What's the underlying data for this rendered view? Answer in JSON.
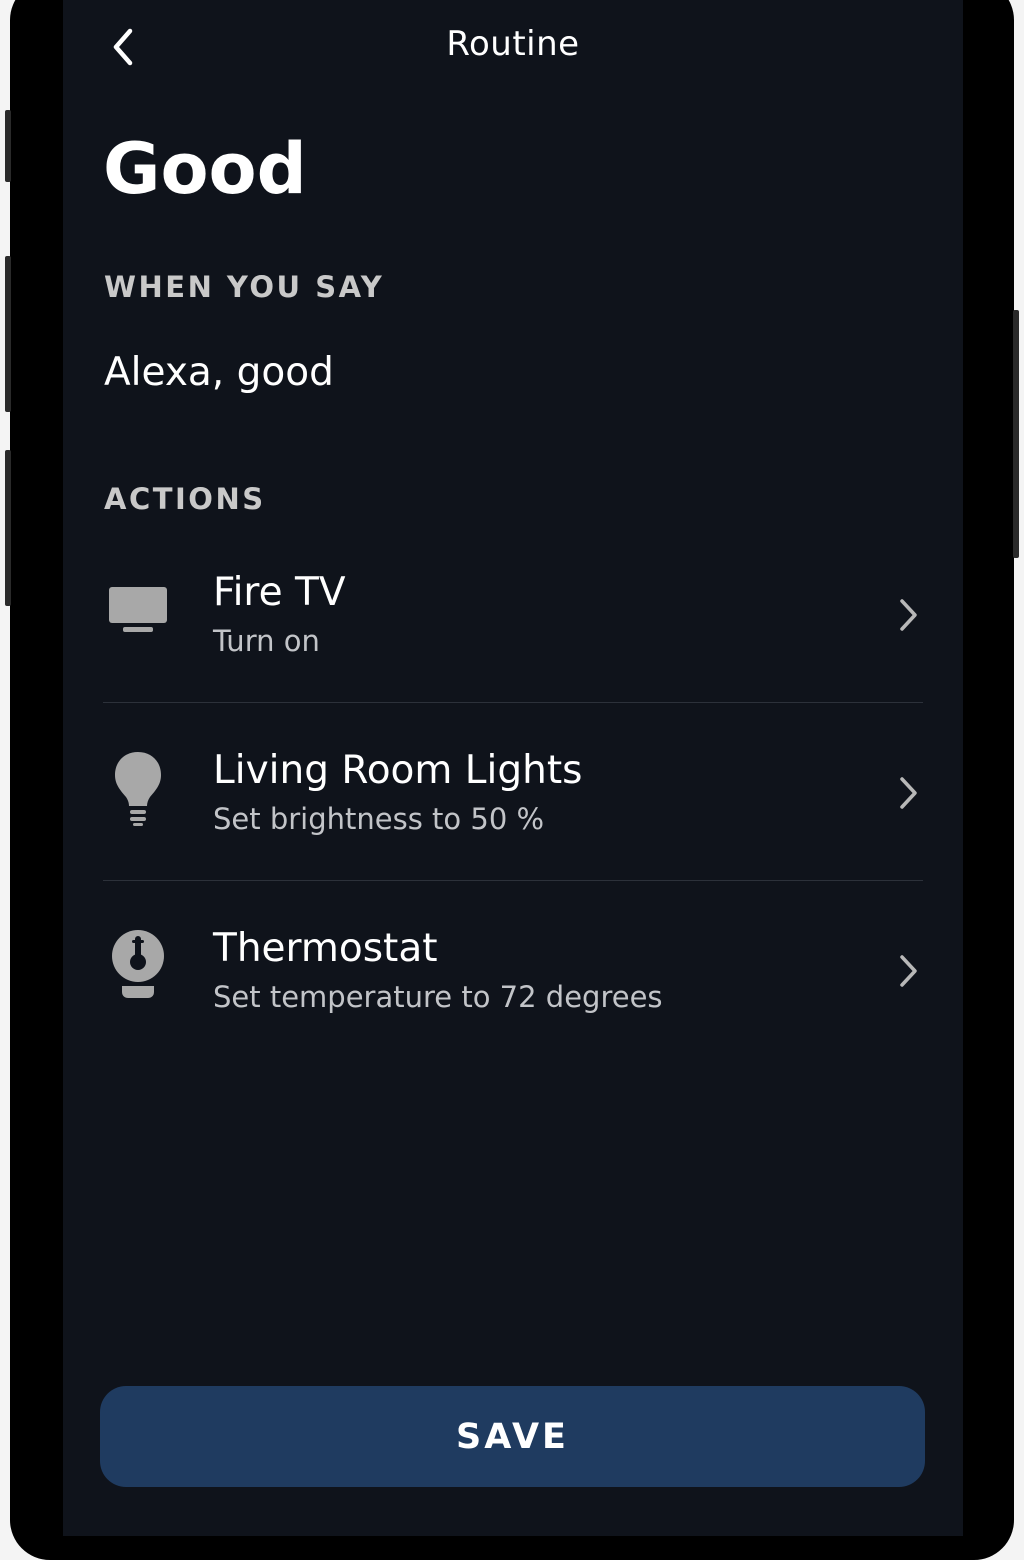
{
  "header": {
    "title": "Routine",
    "back_icon": "chevron-left-icon"
  },
  "routine": {
    "name": "Good"
  },
  "trigger": {
    "label": "WHEN YOU SAY",
    "phrase": "Alexa, good"
  },
  "actions": {
    "label": "ACTIONS",
    "items": [
      {
        "icon": "tv-icon",
        "title": "Fire TV",
        "subtitle": "Turn on"
      },
      {
        "icon": "lightbulb-icon",
        "title": "Living Room Lights",
        "subtitle": "Set brightness to 50 %"
      },
      {
        "icon": "thermostat-icon",
        "title": "Thermostat",
        "subtitle": "Set temperature to 72 degrees"
      }
    ]
  },
  "footer": {
    "save_label": "SAVE"
  },
  "colors": {
    "background": "#0f131b",
    "save_button": "#1f3b60",
    "icon": "#a8a8a8"
  }
}
